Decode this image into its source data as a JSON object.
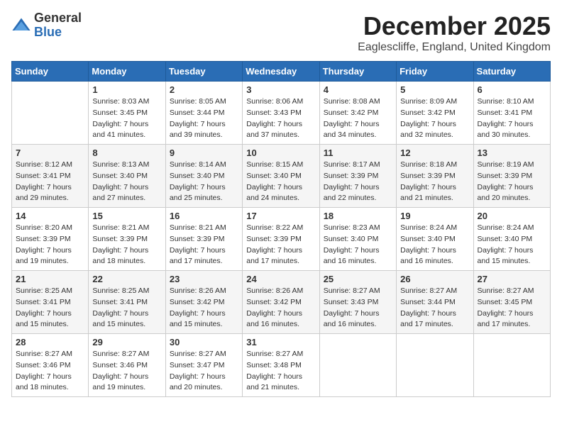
{
  "logo": {
    "general": "General",
    "blue": "Blue"
  },
  "header": {
    "month": "December 2025",
    "location": "Eaglescliffe, England, United Kingdom"
  },
  "weekdays": [
    "Sunday",
    "Monday",
    "Tuesday",
    "Wednesday",
    "Thursday",
    "Friday",
    "Saturday"
  ],
  "weeks": [
    [
      {
        "day": "",
        "sunrise": "",
        "sunset": "",
        "daylight": ""
      },
      {
        "day": "1",
        "sunrise": "Sunrise: 8:03 AM",
        "sunset": "Sunset: 3:45 PM",
        "daylight": "Daylight: 7 hours and 41 minutes."
      },
      {
        "day": "2",
        "sunrise": "Sunrise: 8:05 AM",
        "sunset": "Sunset: 3:44 PM",
        "daylight": "Daylight: 7 hours and 39 minutes."
      },
      {
        "day": "3",
        "sunrise": "Sunrise: 8:06 AM",
        "sunset": "Sunset: 3:43 PM",
        "daylight": "Daylight: 7 hours and 37 minutes."
      },
      {
        "day": "4",
        "sunrise": "Sunrise: 8:08 AM",
        "sunset": "Sunset: 3:42 PM",
        "daylight": "Daylight: 7 hours and 34 minutes."
      },
      {
        "day": "5",
        "sunrise": "Sunrise: 8:09 AM",
        "sunset": "Sunset: 3:42 PM",
        "daylight": "Daylight: 7 hours and 32 minutes."
      },
      {
        "day": "6",
        "sunrise": "Sunrise: 8:10 AM",
        "sunset": "Sunset: 3:41 PM",
        "daylight": "Daylight: 7 hours and 30 minutes."
      }
    ],
    [
      {
        "day": "7",
        "sunrise": "Sunrise: 8:12 AM",
        "sunset": "Sunset: 3:41 PM",
        "daylight": "Daylight: 7 hours and 29 minutes."
      },
      {
        "day": "8",
        "sunrise": "Sunrise: 8:13 AM",
        "sunset": "Sunset: 3:40 PM",
        "daylight": "Daylight: 7 hours and 27 minutes."
      },
      {
        "day": "9",
        "sunrise": "Sunrise: 8:14 AM",
        "sunset": "Sunset: 3:40 PM",
        "daylight": "Daylight: 7 hours and 25 minutes."
      },
      {
        "day": "10",
        "sunrise": "Sunrise: 8:15 AM",
        "sunset": "Sunset: 3:40 PM",
        "daylight": "Daylight: 7 hours and 24 minutes."
      },
      {
        "day": "11",
        "sunrise": "Sunrise: 8:17 AM",
        "sunset": "Sunset: 3:39 PM",
        "daylight": "Daylight: 7 hours and 22 minutes."
      },
      {
        "day": "12",
        "sunrise": "Sunrise: 8:18 AM",
        "sunset": "Sunset: 3:39 PM",
        "daylight": "Daylight: 7 hours and 21 minutes."
      },
      {
        "day": "13",
        "sunrise": "Sunrise: 8:19 AM",
        "sunset": "Sunset: 3:39 PM",
        "daylight": "Daylight: 7 hours and 20 minutes."
      }
    ],
    [
      {
        "day": "14",
        "sunrise": "Sunrise: 8:20 AM",
        "sunset": "Sunset: 3:39 PM",
        "daylight": "Daylight: 7 hours and 19 minutes."
      },
      {
        "day": "15",
        "sunrise": "Sunrise: 8:21 AM",
        "sunset": "Sunset: 3:39 PM",
        "daylight": "Daylight: 7 hours and 18 minutes."
      },
      {
        "day": "16",
        "sunrise": "Sunrise: 8:21 AM",
        "sunset": "Sunset: 3:39 PM",
        "daylight": "Daylight: 7 hours and 17 minutes."
      },
      {
        "day": "17",
        "sunrise": "Sunrise: 8:22 AM",
        "sunset": "Sunset: 3:39 PM",
        "daylight": "Daylight: 7 hours and 17 minutes."
      },
      {
        "day": "18",
        "sunrise": "Sunrise: 8:23 AM",
        "sunset": "Sunset: 3:40 PM",
        "daylight": "Daylight: 7 hours and 16 minutes."
      },
      {
        "day": "19",
        "sunrise": "Sunrise: 8:24 AM",
        "sunset": "Sunset: 3:40 PM",
        "daylight": "Daylight: 7 hours and 16 minutes."
      },
      {
        "day": "20",
        "sunrise": "Sunrise: 8:24 AM",
        "sunset": "Sunset: 3:40 PM",
        "daylight": "Daylight: 7 hours and 15 minutes."
      }
    ],
    [
      {
        "day": "21",
        "sunrise": "Sunrise: 8:25 AM",
        "sunset": "Sunset: 3:41 PM",
        "daylight": "Daylight: 7 hours and 15 minutes."
      },
      {
        "day": "22",
        "sunrise": "Sunrise: 8:25 AM",
        "sunset": "Sunset: 3:41 PM",
        "daylight": "Daylight: 7 hours and 15 minutes."
      },
      {
        "day": "23",
        "sunrise": "Sunrise: 8:26 AM",
        "sunset": "Sunset: 3:42 PM",
        "daylight": "Daylight: 7 hours and 15 minutes."
      },
      {
        "day": "24",
        "sunrise": "Sunrise: 8:26 AM",
        "sunset": "Sunset: 3:42 PM",
        "daylight": "Daylight: 7 hours and 16 minutes."
      },
      {
        "day": "25",
        "sunrise": "Sunrise: 8:27 AM",
        "sunset": "Sunset: 3:43 PM",
        "daylight": "Daylight: 7 hours and 16 minutes."
      },
      {
        "day": "26",
        "sunrise": "Sunrise: 8:27 AM",
        "sunset": "Sunset: 3:44 PM",
        "daylight": "Daylight: 7 hours and 17 minutes."
      },
      {
        "day": "27",
        "sunrise": "Sunrise: 8:27 AM",
        "sunset": "Sunset: 3:45 PM",
        "daylight": "Daylight: 7 hours and 17 minutes."
      }
    ],
    [
      {
        "day": "28",
        "sunrise": "Sunrise: 8:27 AM",
        "sunset": "Sunset: 3:46 PM",
        "daylight": "Daylight: 7 hours and 18 minutes."
      },
      {
        "day": "29",
        "sunrise": "Sunrise: 8:27 AM",
        "sunset": "Sunset: 3:46 PM",
        "daylight": "Daylight: 7 hours and 19 minutes."
      },
      {
        "day": "30",
        "sunrise": "Sunrise: 8:27 AM",
        "sunset": "Sunset: 3:47 PM",
        "daylight": "Daylight: 7 hours and 20 minutes."
      },
      {
        "day": "31",
        "sunrise": "Sunrise: 8:27 AM",
        "sunset": "Sunset: 3:48 PM",
        "daylight": "Daylight: 7 hours and 21 minutes."
      },
      {
        "day": "",
        "sunrise": "",
        "sunset": "",
        "daylight": ""
      },
      {
        "day": "",
        "sunrise": "",
        "sunset": "",
        "daylight": ""
      },
      {
        "day": "",
        "sunrise": "",
        "sunset": "",
        "daylight": ""
      }
    ]
  ]
}
